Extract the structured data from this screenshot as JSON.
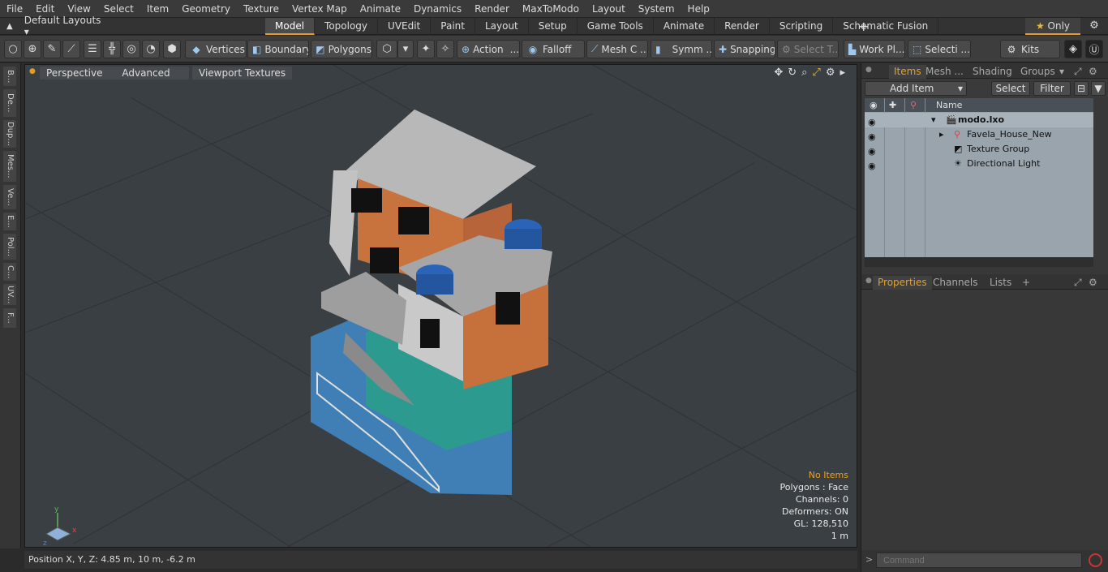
{
  "menu": [
    "File",
    "Edit",
    "View",
    "Select",
    "Item",
    "Geometry",
    "Texture",
    "Vertex Map",
    "Animate",
    "Dynamics",
    "Render",
    "MaxToModo",
    "Layout",
    "System",
    "Help"
  ],
  "layout_selector": "Default Layouts",
  "tabs": [
    "Model",
    "Topology",
    "UVEdit",
    "Paint",
    "Layout",
    "Setup",
    "Game Tools",
    "Animate",
    "Render",
    "Scripting",
    "Schematic Fusion"
  ],
  "active_tab": "Model",
  "only_label": "Only",
  "toolbar": {
    "vertices": "Vertices",
    "boundary": "Boundary",
    "polygons": "Polygons",
    "action": "Action",
    "falloff": "Falloff",
    "mesh": "Mesh C ...",
    "symm": "Symm ...",
    "snapping": "Snapping",
    "select_t": "Select T...",
    "work_pl": "Work Pl...",
    "selecti": "Selecti ...",
    "kits": "Kits"
  },
  "left_tabs": [
    "B...",
    "De...",
    "Dup...",
    "Mes...",
    "Ve...",
    "E...",
    "Pol...",
    "C...",
    "UV...",
    "F..."
  ],
  "viewport": {
    "perspective": "Perspective",
    "advanced": "Advanced",
    "textures": "Viewport Textures",
    "info": {
      "no_items": "No Items",
      "polygons": "Polygons : Face",
      "channels": "Channels: 0",
      "deformers": "Deformers: ON",
      "gl": "GL: 128,510",
      "scale": "1 m"
    }
  },
  "status": {
    "position": "Position X, Y, Z:   4.85 m, 10 m, -6.2 m"
  },
  "right_panel": {
    "tabs": [
      "Items",
      "Mesh ...",
      "Shading",
      "Groups"
    ],
    "add_item": "Add Item",
    "select": "Select",
    "filter": "Filter",
    "name_header": "Name",
    "tree": [
      {
        "label": "modo.lxo"
      },
      {
        "label": "Favela_House_New"
      },
      {
        "label": "Texture Group"
      },
      {
        "label": "Directional Light"
      }
    ],
    "prop_tabs": [
      "Properties",
      "Channels",
      "Lists"
    ],
    "command_placeholder": "Command"
  },
  "colors": {
    "accent": "#e69a27",
    "viewport_bg": "#3a3f44",
    "tree_bg": "#9aa4ad"
  }
}
